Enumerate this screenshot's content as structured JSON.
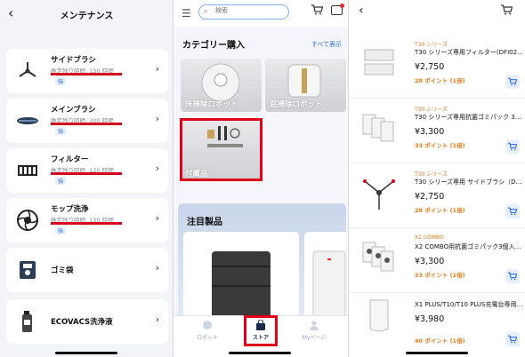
{
  "maintenance": {
    "back_icon": "chevron-left-icon",
    "title": "メンテナンス",
    "items": [
      {
        "name": "サイドブラシ",
        "life": "推定残り時間: 150 時間",
        "badge": "強",
        "icon": "side-brush-icon"
      },
      {
        "name": "メインブラシ",
        "life": "推定残り時間: 300 時間",
        "badge": "強",
        "icon": "main-brush-icon"
      },
      {
        "name": "フィルター",
        "life": "推定残り時間: 120 時間",
        "badge": "強",
        "icon": "filter-icon"
      },
      {
        "name": "モップ洗浄",
        "life": "推定残り時間: 150 時間",
        "badge": "強",
        "icon": "mop-icon"
      },
      {
        "name": "ゴミ袋",
        "icon": "dust-bag-icon"
      },
      {
        "name": "ECOVACS洗浄液",
        "icon": "cleaning-liquid-icon"
      }
    ],
    "chevron": "›"
  },
  "store": {
    "search": {
      "placeholder": "検索"
    },
    "category_title": "カテゴリー購入",
    "view_all": "すべて表示",
    "categories": [
      {
        "label": "床掃除ロボット"
      },
      {
        "label": "窓掃除ロボット"
      },
      {
        "label": "付属品"
      }
    ],
    "featured_title": "注目製品",
    "tabs": [
      {
        "label": "ロボット"
      },
      {
        "label": "ストア"
      },
      {
        "label": "Myページ"
      }
    ],
    "active_tab": "ストア",
    "highlight_color": "#e0001a",
    "accent_color": "#2e6be6"
  },
  "accessories": {
    "back_icon": "chevron-left-icon",
    "cart_icon": "cart-icon",
    "items": [
      {
        "series": "T30 シリーズ",
        "name": "T30 シリーズ専用フィルター(DFI02…",
        "price": "¥2,750",
        "points": "28 ポイント (1倍)"
      },
      {
        "series": "T30 シリーズ",
        "name": "T30 シリーズ専用抗菌ゴミパック 3…",
        "price": "¥3,300",
        "points": "33 ポイント (1倍)"
      },
      {
        "series": "T30 シリーズ",
        "name": "T30 シリーズ専用 サイドブラシ（D…",
        "price": "¥2,750",
        "points": "28 ポイント (1倍)"
      },
      {
        "series": "X2 COMBO",
        "name": "X2 COMBO用抗菌ゴミパック3個入…",
        "price": "¥3,300",
        "points": "33 ポイント (1倍)"
      },
      {
        "series": "",
        "name": "X1 PLUS/T10/T10 PLUS充電台専用…",
        "price": "¥3,980",
        "points": "40 ポイント (1倍)"
      }
    ],
    "series_color": "#e57a1b"
  }
}
